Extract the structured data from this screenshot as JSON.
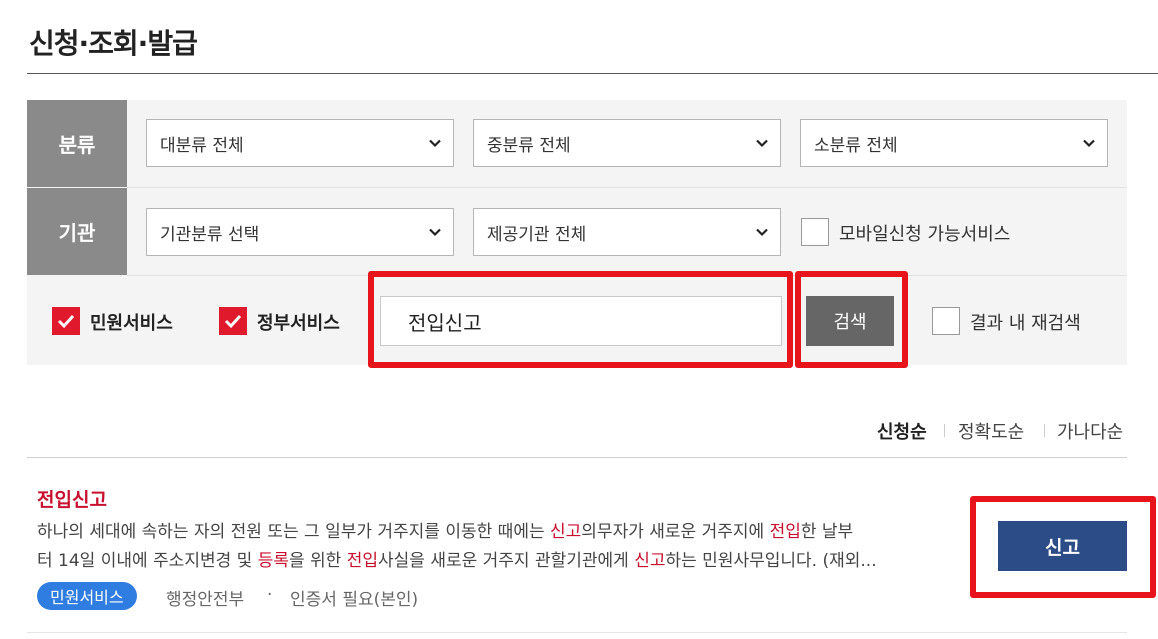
{
  "page": {
    "title": "신청·조회·발급"
  },
  "filters": {
    "category_label": "분류",
    "agency_label": "기관",
    "major_category": "대분류 전체",
    "middle_category": "중분류 전체",
    "minor_category": "소분류 전체",
    "agency_type": "기관분류 선택",
    "provider_agency": "제공기관 전체",
    "mobile_option_label": "모바일신청 가능서비스",
    "civil_service_label": "민원서비스",
    "gov_service_label": "정부서비스",
    "search_value": "전입신고",
    "search_button": "검색",
    "research_label": "결과 내 재검색",
    "icons": {
      "dropdown": "chevron-down-icon",
      "check": "check-icon"
    },
    "colors": {
      "checked": "#e0192c",
      "highlight": "#e8141c"
    }
  },
  "sort": {
    "options": [
      "신청순",
      "정확도순",
      "가나다순"
    ],
    "active": "신청순"
  },
  "result": {
    "title": "전입신고",
    "desc_line1": [
      "하나의 세대에 속하는 자의 전원 또는 그 일부가 거주지를 이동한 때에는 ",
      "신고",
      "의무자가 새로운 거주지에 ",
      "전입",
      "한 날부"
    ],
    "desc_line2": [
      "터 14일 이내에 주소지변경 및 ",
      "등록",
      "을 위한 ",
      "전입",
      "사실을 새로운 거주지 관할기관에게 ",
      "신고",
      "하는 민원사무입니다. (재외..."
    ],
    "badge": "민원서비스",
    "ministry": "행정안전부",
    "separator": "·",
    "cert": "인증서 필요(본인)",
    "action_button": "신고",
    "colors": {
      "keyword": "#c8102e",
      "badge": "#2f7de1",
      "button": "#2b4c86"
    }
  }
}
